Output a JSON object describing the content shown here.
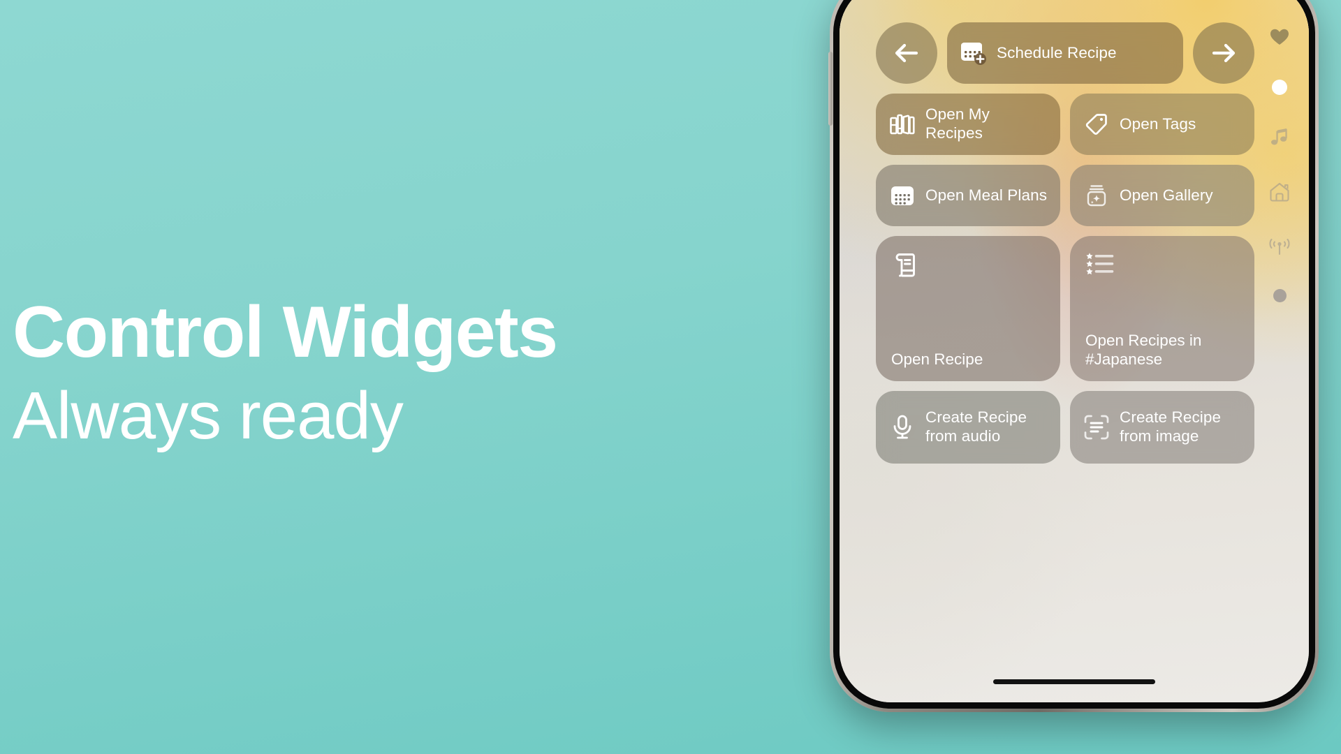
{
  "marketing": {
    "title": "Control Widgets",
    "subtitle": "Always ready"
  },
  "colors": {
    "page_background_top": "#8ed8d2",
    "page_background_bottom": "#6cc9c2",
    "text": "#ffffff",
    "control_tint": "#7a6a4e"
  },
  "control_center": {
    "top_row": {
      "back_button": {
        "icon": "arrow-left-icon",
        "label": ""
      },
      "schedule": {
        "icon": "calendar-badge-plus-icon",
        "label": "Schedule Recipe"
      },
      "forward_button": {
        "icon": "arrow-right-icon",
        "label": ""
      }
    },
    "controls": [
      {
        "icon": "books-icon",
        "label": "Open My Recipes"
      },
      {
        "icon": "tag-icon",
        "label": "Open Tags"
      },
      {
        "icon": "calendar-icon",
        "label": "Open Meal Plans"
      },
      {
        "icon": "jar-sparkle-icon",
        "label": "Open Gallery"
      },
      {
        "icon": "scroll-icon",
        "label": "Open Recipe"
      },
      {
        "icon": "star-list-icon",
        "label": "Open Recipes in #Japanese"
      },
      {
        "icon": "microphone-icon",
        "label": "Create Recipe from audio"
      },
      {
        "icon": "text-scan-icon",
        "label": "Create Recipe from image"
      }
    ]
  },
  "rail": {
    "items": [
      {
        "icon": "heart-icon",
        "name": "favorites"
      },
      {
        "icon": "page-dot-active",
        "name": "page-indicator-active"
      },
      {
        "icon": "music-note-icon",
        "name": "now-playing"
      },
      {
        "icon": "home-icon",
        "name": "home"
      },
      {
        "icon": "airplay-icon",
        "name": "connectivity"
      },
      {
        "icon": "page-dot",
        "name": "page-indicator"
      }
    ]
  }
}
